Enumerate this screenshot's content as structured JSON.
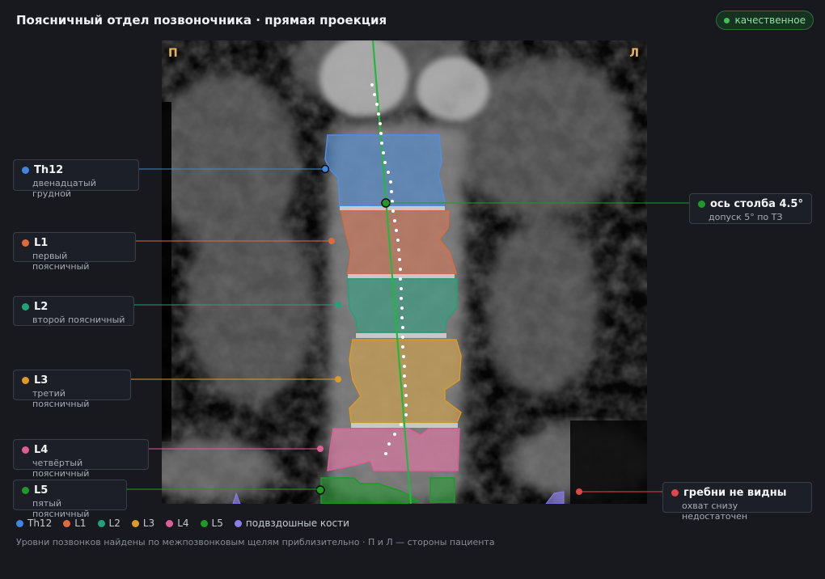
{
  "header": {
    "title": "Поясничный отдел позвоночника · прямая проекция",
    "quality_badge": "качественное"
  },
  "scan": {
    "side_left": "П",
    "side_right": "Л"
  },
  "labels": {
    "th12": {
      "name": "Th12",
      "desc": "двенадцатый грудной",
      "color": "#3f86e0"
    },
    "l1": {
      "name": "L1",
      "desc": "первый поясничный",
      "color": "#e06a3c"
    },
    "l2": {
      "name": "L2",
      "desc": "второй поясничный",
      "color": "#1fa37a"
    },
    "l3": {
      "name": "L3",
      "desc": "третий поясничный",
      "color": "#dc9a26"
    },
    "l4": {
      "name": "L4",
      "desc": "четвёртый поясничный",
      "color": "#dd5f96"
    },
    "l5": {
      "name": "L5",
      "desc": "пятый поясничный",
      "color": "#1e9a2a"
    },
    "axis": {
      "name": "ось столба 4.5°",
      "desc": "допуск 5° по ТЗ",
      "color": "#1e9a2a"
    },
    "crests": {
      "name": "гребни не видны",
      "desc": "охват снизу недостаточен",
      "color": "#e0474c"
    }
  },
  "legend": [
    {
      "label": "Th12",
      "color": "#3f86e0"
    },
    {
      "label": "L1",
      "color": "#e06a3c"
    },
    {
      "label": "L2",
      "color": "#1fa37a"
    },
    {
      "label": "L3",
      "color": "#dc9a26"
    },
    {
      "label": "L4",
      "color": "#dd5f96"
    },
    {
      "label": "L5",
      "color": "#1e9a2a"
    },
    {
      "label": "подвздошные кости",
      "color": "#8a7fe6"
    }
  ],
  "footnote": "Уровни позвонков найдены по межпозвонковым щелям приблизительно · П и Л — стороны пациента"
}
